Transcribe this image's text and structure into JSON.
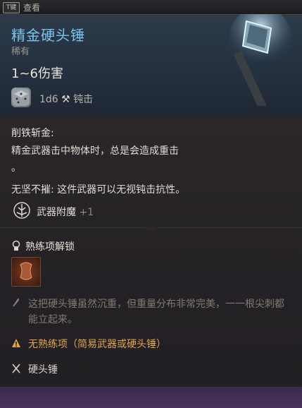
{
  "top": {
    "key_label": "T键",
    "view_label": "查看"
  },
  "item": {
    "name": "精金硬头锤",
    "rarity": "稀有",
    "damage": "1~6伤害",
    "dice_text": "1d6",
    "damage_type": "钝击"
  },
  "passive": {
    "title": "削铁斩金:",
    "description_line1": "精金武器击中物体时，总是会造成重击",
    "description_line2": "。",
    "second": "无坚不摧: 这件武器可以无视钝击抗性。"
  },
  "enchant": {
    "label": "武器附魔",
    "bonus": "+1"
  },
  "proficiency": {
    "header": "熟练项解锁",
    "flavor": "这把硬头锤虽然沉重，但重量分布非常完美，一一根尖刺都能立起来。",
    "warning": "无熟练项（简易武器或硬头锤）",
    "weapon_type": "硬头锤"
  },
  "colors": {
    "title": "#7cc6ee",
    "warning": "#e0a64c",
    "flavor": "#7e7a72"
  }
}
